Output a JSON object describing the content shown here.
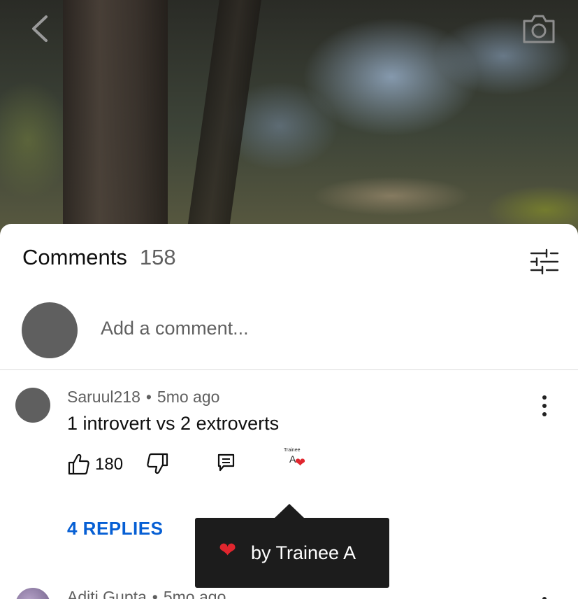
{
  "video": {
    "back_icon": "chevron-left-icon",
    "camera_icon": "camera-icon"
  },
  "comments_panel": {
    "title": "Comments",
    "count": "158",
    "filter_icon": "sliders-icon",
    "add_comment_placeholder": "Add a comment..."
  },
  "comments": [
    {
      "author": "Saruul218",
      "separator": "•",
      "time": "5mo ago",
      "text": "1 introvert vs 2 extroverts",
      "likes": "180",
      "creator_heart": {
        "badge_small": "Trainee",
        "badge_letter": "A"
      },
      "replies_label": "4 REPLIES"
    },
    {
      "author": "Aditi Gupta",
      "separator": "•",
      "time": "5mo ago"
    }
  ],
  "tooltip": {
    "heart": "❤",
    "text": "by Trainee A"
  },
  "colors": {
    "accent_link": "#065fd4",
    "heart": "#e0262e",
    "tooltip_bg": "#1c1c1c"
  }
}
